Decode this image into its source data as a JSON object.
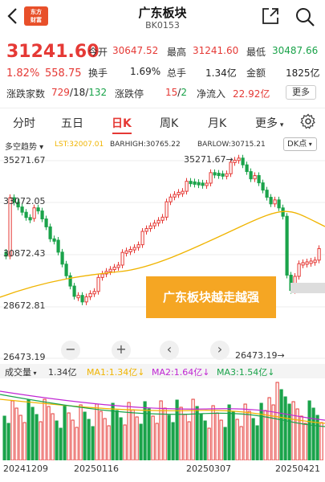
{
  "header": {
    "title": "广东板块",
    "code": "BK0153",
    "logo_text_1": "东方",
    "logo_text_2": "财富"
  },
  "quote": {
    "price": "31241.60",
    "change_pct": "1.82%",
    "change": "558.75",
    "open_label": "今开",
    "open": "30647.52",
    "high_label": "最高",
    "high": "31241.60",
    "low_label": "最低",
    "low": "30487.66",
    "turnover_label": "换手",
    "turnover": "1.69%",
    "volume_label": "总手",
    "volume": "1.34亿",
    "amount_label": "金额",
    "amount": "1825亿",
    "breadth_label": "涨跌家数",
    "up": "729",
    "sep1": "/",
    "flat": "18",
    "sep2": "/",
    "down": "132",
    "limit_label": "涨跌停",
    "limit_up": "15",
    "sep3": "/",
    "limit_down": "2",
    "inflow_label": "净流入",
    "inflow": "22.92亿",
    "more": "更多"
  },
  "tabs": [
    "分时",
    "五日",
    "日K",
    "周K",
    "月K",
    "更多"
  ],
  "indicators": {
    "name": "多空趋势",
    "lst": "LST:32007.01",
    "barhigh": "BARHIGH:30765.22",
    "barlow": "BARLOW:30715.21",
    "dk": "DK点"
  },
  "chart_data": {
    "type": "candlestick",
    "y_ticks": [
      "35271.67",
      "33072.05",
      "30872.43",
      "28672.81",
      "26473.19"
    ],
    "max_label": "35271.67",
    "min_label": "26473.19",
    "banner": "广东板块越走越强",
    "x_labels": [
      "20241209",
      "20250116",
      "20250307",
      "20250421"
    ],
    "volume_header": "成交量",
    "vol": "1.34亿",
    "ma1": "MA1:1.34亿",
    "ma2": "MA2:1.64亿",
    "ma3": "MA3:1.54亿",
    "colors": {
      "up": "#e53935",
      "down": "#1aa34a",
      "ma": "#f0b400",
      "ma2": "#c026d3",
      "ma3": "#1aa34a"
    }
  }
}
